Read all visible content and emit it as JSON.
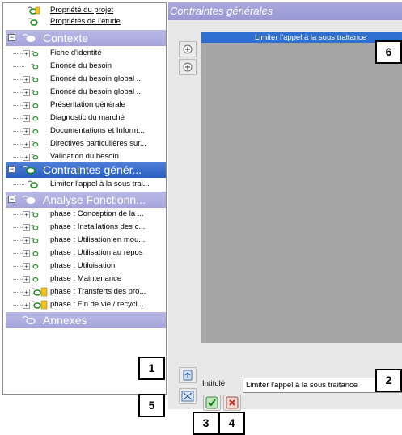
{
  "tree": {
    "top_items": [
      {
        "label": "Propriété du projet",
        "icon": "project-properties-icon"
      },
      {
        "label": "Propriétés de l'étude",
        "icon": "study-properties-icon"
      }
    ],
    "sections": [
      {
        "label": "Contexte",
        "expanded": true,
        "selected": false,
        "items": [
          "Fiche d'identité",
          "Enoncé du besoin",
          "Enoncé du besoin global ...",
          "Enoncé du besoin global ...",
          "Présentation générale",
          "Diagnostic du marché",
          "Documentations et Inform...",
          "Directives particulières sur...",
          "Validation du besoin"
        ]
      },
      {
        "label": "Contraintes génér...",
        "expanded": true,
        "selected": true,
        "items": [
          "Limiter l'appel à la sous trai..."
        ]
      },
      {
        "label": "Analyse Fonctionn...",
        "expanded": true,
        "selected": false,
        "items": [
          "phase : Conception de la ...",
          "phase : Installations des c...",
          "phase : Utilisation en mou...",
          "phase : Utilisation au repos",
          "phase : Utiloisation",
          "phase : Maintenance",
          "phase : Transferts des pro...",
          "phase : Fin de vie / recycl..."
        ]
      },
      {
        "label": "Annexes",
        "expanded": false,
        "selected": false,
        "items": []
      }
    ]
  },
  "panel": {
    "title": "Contraintes générales",
    "list_selected_item": "Limiter l'appel à la sous traitance",
    "intitule_label": "Intitulé",
    "intitule_value": "Limiter l'appel à la sous traitance"
  },
  "callouts": [
    "1",
    "2",
    "3",
    "4",
    "5",
    "6"
  ],
  "colors": {
    "section_header": "#a5a5dc",
    "section_selected": "#2c5fc4",
    "list_background": "#a6a6a6",
    "list_selection": "#2f6fd0"
  }
}
